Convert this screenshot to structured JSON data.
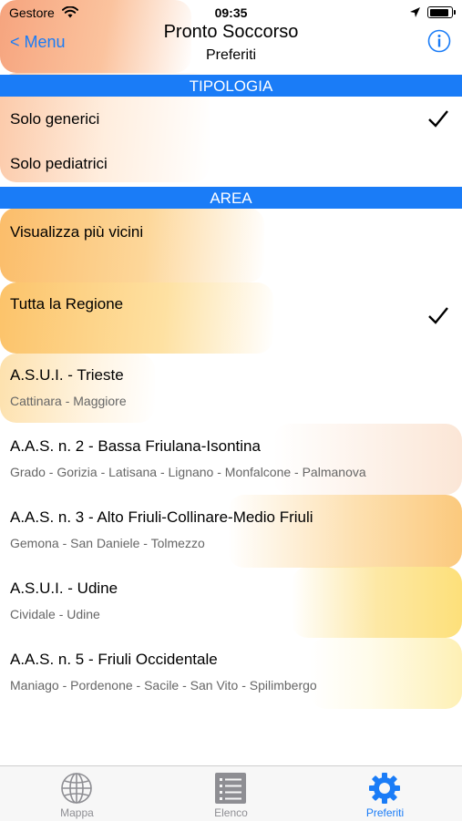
{
  "status_bar": {
    "carrier": "Gestore",
    "time": "09:35"
  },
  "nav": {
    "back_label": "< Menu",
    "title": "Pronto Soccorso",
    "subtitle": "Preferiti"
  },
  "sections": {
    "tipologia": "TIPOLOGIA",
    "area": "AREA"
  },
  "tipologia_items": [
    {
      "label": "Solo generici",
      "checked": true
    },
    {
      "label": "Solo pediatrici",
      "checked": false
    }
  ],
  "area_items": [
    {
      "label": "Visualizza più vicini",
      "detail": "",
      "checked": false
    },
    {
      "label": "Tutta la Regione",
      "detail": "",
      "checked": true
    },
    {
      "label": "A.S.U.I. - Trieste",
      "detail": "Cattinara - Maggiore",
      "checked": false
    },
    {
      "label": "A.A.S. n. 2 - Bassa Friulana-Isontina",
      "detail": "Grado - Gorizia - Latisana - Lignano - Monfalcone - Palmanova",
      "checked": false
    },
    {
      "label": "A.A.S. n. 3 - Alto Friuli-Collinare-Medio Friuli",
      "detail": "Gemona - San Daniele - Tolmezzo",
      "checked": false
    },
    {
      "label": "A.S.U.I. - Udine",
      "detail": "Cividale - Udine",
      "checked": false
    },
    {
      "label": "A.A.S. n. 5 - Friuli Occidentale",
      "detail": "Maniago - Pordenone - Sacile - San Vito - Spilimbergo",
      "checked": false
    }
  ],
  "tab_bar": [
    {
      "label": "Mappa",
      "icon": "globe-icon",
      "active": false
    },
    {
      "label": "Elenco",
      "icon": "list-icon",
      "active": false
    },
    {
      "label": "Preferiti",
      "icon": "gear-icon",
      "active": true
    }
  ],
  "colors": {
    "accent": "#1a7cf7",
    "section_header_bg": "#1a7cf7",
    "inactive_tab": "#8e8e93"
  }
}
